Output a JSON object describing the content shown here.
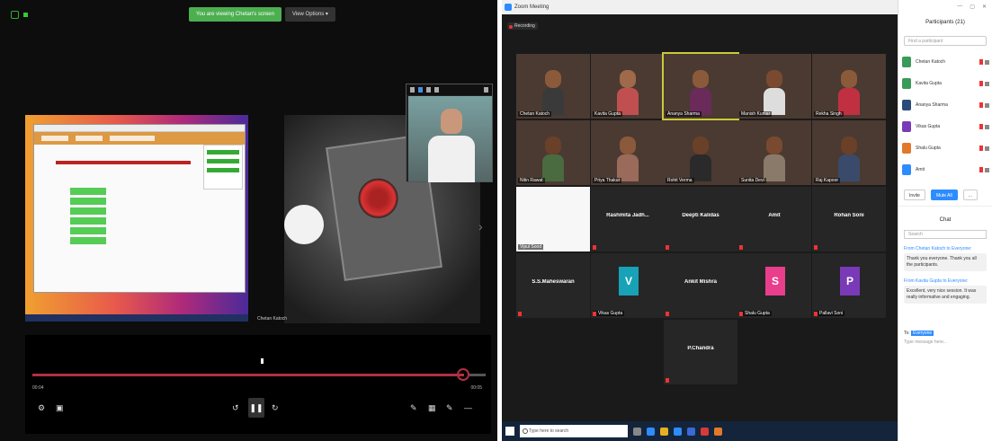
{
  "left": {
    "share_status": "You are viewing Chetan's screen",
    "view_options": "View Options ▾",
    "camera_label": "Chetan Katoch",
    "player": {
      "time_left": "00:04",
      "time_right": "00:05"
    }
  },
  "zoom": {
    "title": "Zoom Meeting",
    "recording": "Recording",
    "tiles": [
      {
        "name": "Chetan Katoch",
        "type": "video",
        "skin": "#8a5a3a",
        "shirt": "#3a3a3a"
      },
      {
        "name": "Kavita Gupta",
        "type": "video",
        "skin": "#a06a4a",
        "shirt": "#c05050"
      },
      {
        "name": "Ananya Sharma",
        "type": "video",
        "skin": "#8a5a3a",
        "shirt": "#6a2a5a",
        "active": true
      },
      {
        "name": "Manish Kumar",
        "type": "video",
        "skin": "#7a4a30",
        "shirt": "#dddddd"
      },
      {
        "name": "Rekha Singh",
        "type": "video",
        "skin": "#8a5a3a",
        "shirt": "#c03040"
      },
      {
        "name": "Nitin Rawat",
        "type": "video",
        "skin": "#6a4028",
        "shirt": "#4a6a40"
      },
      {
        "name": "Priya Thakur",
        "type": "video",
        "skin": "#8a5a3a",
        "shirt": "#9a6a5a"
      },
      {
        "name": "Rohit Verma",
        "type": "video",
        "skin": "#6a4028",
        "shirt": "#2a2a2a"
      },
      {
        "name": "Sunita Devi",
        "type": "video",
        "skin": "#7a4a30",
        "shirt": "#8a7a6a"
      },
      {
        "name": "Raj Kapoor",
        "type": "video",
        "skin": "#6a4028",
        "shirt": "#3a4a6a"
      },
      {
        "name": "Vipul Sood",
        "type": "screen"
      },
      {
        "name": "Rashmita Jadh...",
        "type": "name"
      },
      {
        "name": "Deepti Kalidas",
        "type": "name"
      },
      {
        "name": "Amit",
        "type": "name"
      },
      {
        "name": "Rohan Soni",
        "type": "name"
      },
      {
        "name": "S.S.Maheswaran",
        "type": "name"
      },
      {
        "name": "Vikas Gupta",
        "type": "avatar",
        "letter": "V",
        "color": "#17a2b8"
      },
      {
        "name": "Ankit Mishra",
        "type": "name"
      },
      {
        "name": "Shalu Gupta",
        "type": "avatar",
        "letter": "S",
        "color": "#e83e8c"
      },
      {
        "name": "Pallavi Soni",
        "type": "avatar",
        "letter": "P",
        "color": "#7a3ab8"
      },
      {
        "name": "P.Chandra",
        "type": "name"
      }
    ],
    "taskbar": {
      "search_placeholder": "Type here to search"
    }
  },
  "side": {
    "title": "Participants (21)",
    "search_placeholder": "Find a participant",
    "participants": [
      {
        "name": "Chetan Katoch",
        "color": "#3a9a5a"
      },
      {
        "name": "Kavita Gupta",
        "color": "#3a9a5a"
      },
      {
        "name": "Ananya Sharma",
        "color": "#2a4a7a"
      },
      {
        "name": "Vikas Gupta",
        "color": "#7a3ab8"
      },
      {
        "name": "Shalu Gupta",
        "color": "#e07a2a"
      },
      {
        "name": "Amit",
        "color": "#2d8cff"
      }
    ],
    "invite_label": "Invite",
    "mute_all_label": "Mute All",
    "more_label": "...",
    "chat_title": "Chat",
    "chat_search": "Search",
    "chat": [
      {
        "from": "From Chetan Katoch to Everyone:",
        "msg": "Thank you everyone. Thank you all the participants."
      },
      {
        "from": "From Kavita Gupta to Everyone:",
        "msg": "Excellent, very nice session. It was really informative and engaging."
      }
    ],
    "chat_to_label": "To:",
    "chat_to_value": "Everyone",
    "chat_input_placeholder": "Type message here..."
  }
}
